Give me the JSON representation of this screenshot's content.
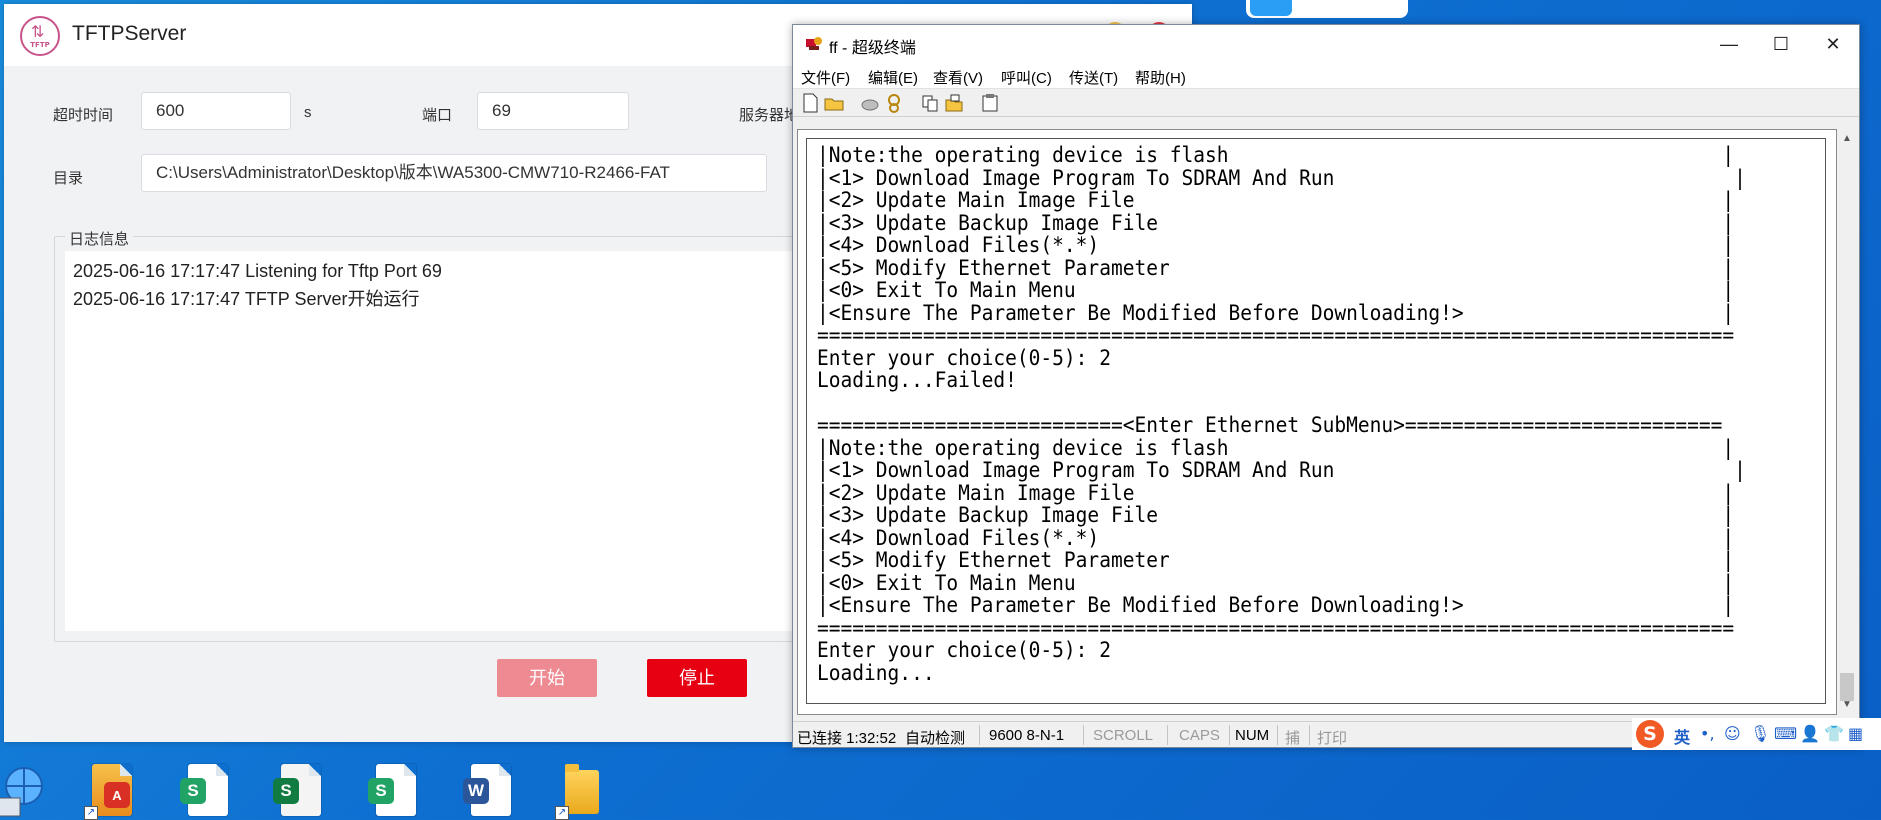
{
  "tftp": {
    "title": "TFTPServer",
    "logo_text": "TFTP",
    "timeout_label": "超时时间",
    "timeout_value": "600",
    "timeout_unit": "s",
    "port_label": "端口",
    "port_value": "69",
    "server_label": "服务器地",
    "dir_label": "目录",
    "dir_value": "C:\\Users\\Administrator\\Desktop\\版本\\WA5300-CMW710-R2466-FAT",
    "log_title": "日志信息",
    "log_lines": [
      "2025-06-16 17:17:47 Listening for Tftp Port 69",
      "2025-06-16 17:17:47 TFTP Server开始运行"
    ],
    "start_label": "开始",
    "stop_label": "停止"
  },
  "terminal": {
    "title": "ff - 超级终端",
    "menus": [
      "文件(F)",
      "编辑(E)",
      "查看(V)",
      "呼叫(C)",
      "传送(T)",
      "帮助(H)"
    ],
    "lines": [
      "|Note:the operating device is flash                                          |",
      "|<1> Download Image Program To SDRAM And Run                                  |",
      "|<2> Update Main Image File                                                  |",
      "|<3> Update Backup Image File                                                |",
      "|<4> Download Files(*.*)                                                     |",
      "|<5> Modify Ethernet Parameter                                               |",
      "|<0> Exit To Main Menu                                                       |",
      "|<Ensure The Parameter Be Modified Before Downloading!>                      |",
      "==============================================================================",
      "Enter your choice(0-5): 2",
      "Loading...Failed!",
      "",
      "==========================<Enter Ethernet SubMenu>===========================",
      "|Note:the operating device is flash                                          |",
      "|<1> Download Image Program To SDRAM And Run                                  |",
      "|<2> Update Main Image File                                                  |",
      "|<3> Update Backup Image File                                                |",
      "|<4> Download Files(*.*)                                                     |",
      "|<5> Modify Ethernet Parameter                                               |",
      "|<0> Exit To Main Menu                                                       |",
      "|<Ensure The Parameter Be Modified Before Downloading!>                      |",
      "==============================================================================",
      "Enter your choice(0-5): 2",
      "Loading..."
    ],
    "status": {
      "connected": "已连接 1:32:52",
      "detect": "自动检测",
      "baud": "9600 8-N-1",
      "scroll": "SCROLL",
      "caps": "CAPS",
      "num": "NUM",
      "capture": "捕",
      "print": "打印"
    }
  },
  "ime": {
    "logo": "S",
    "mode": "英"
  },
  "desktop": {
    "icons": [
      {
        "name": "network-icon"
      },
      {
        "name": "pdf-shortcut-icon"
      },
      {
        "name": "sheet-icon",
        "badge": "S"
      },
      {
        "name": "sheet-icon",
        "badge": "S"
      },
      {
        "name": "sheet-icon",
        "badge": "S"
      },
      {
        "name": "word-icon",
        "badge": "W"
      },
      {
        "name": "folder-shortcut-icon"
      }
    ]
  },
  "colors": {
    "desktop_blue": "#0e6fd1",
    "start_button": "#ee8a92",
    "stop_button": "#e60012",
    "sheet_green": "#21a366",
    "word_blue": "#2b579a"
  }
}
